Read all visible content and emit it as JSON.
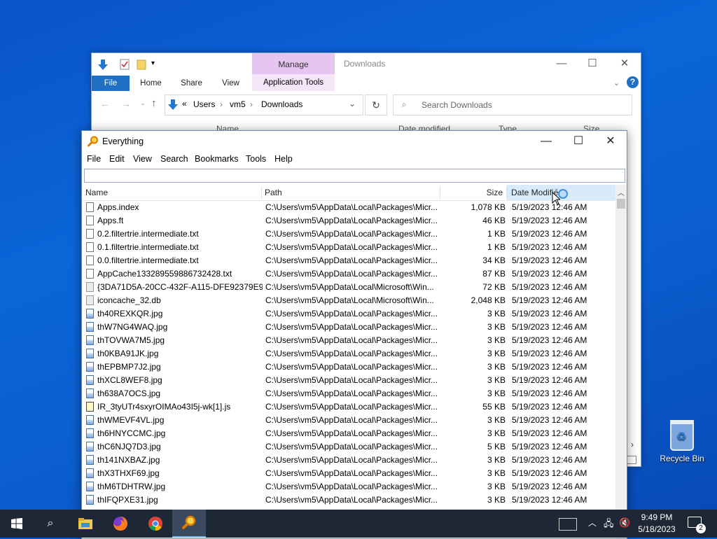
{
  "explorer": {
    "title": "Downloads",
    "manage_label": "Manage",
    "tabs": {
      "file": "File",
      "home": "Home",
      "share": "Share",
      "view": "View",
      "app_tools": "Application Tools"
    },
    "breadcrumb": {
      "sep": "«",
      "items": [
        "Users",
        "vm5",
        "Downloads"
      ]
    },
    "search_placeholder": "Search Downloads",
    "columns": [
      "Name",
      "Date modified",
      "Type",
      "Size"
    ]
  },
  "everything": {
    "title": "Everything",
    "menu": [
      "File",
      "Edit",
      "View",
      "Search",
      "Bookmarks",
      "Tools",
      "Help"
    ],
    "search_value": "",
    "columns": {
      "name": "Name",
      "path": "Path",
      "size": "Size",
      "date": "Date Modified"
    },
    "rows": [
      {
        "name": "Apps.index",
        "path": "C:\\Users\\vm5\\AppData\\Local\\Packages\\Micr...",
        "size": "1,078 KB",
        "date": "5/19/2023 12:46 AM",
        "icon": "file-icon"
      },
      {
        "name": "Apps.ft",
        "path": "C:\\Users\\vm5\\AppData\\Local\\Packages\\Micr...",
        "size": "46 KB",
        "date": "5/19/2023 12:46 AM",
        "icon": "file-icon"
      },
      {
        "name": "0.2.filtertrie.intermediate.txt",
        "path": "C:\\Users\\vm5\\AppData\\Local\\Packages\\Micr...",
        "size": "1 KB",
        "date": "5/19/2023 12:46 AM",
        "icon": "text-file-icon"
      },
      {
        "name": "0.1.filtertrie.intermediate.txt",
        "path": "C:\\Users\\vm5\\AppData\\Local\\Packages\\Micr...",
        "size": "1 KB",
        "date": "5/19/2023 12:46 AM",
        "icon": "text-file-icon"
      },
      {
        "name": "0.0.filtertrie.intermediate.txt",
        "path": "C:\\Users\\vm5\\AppData\\Local\\Packages\\Micr...",
        "size": "34 KB",
        "date": "5/19/2023 12:46 AM",
        "icon": "text-file-icon"
      },
      {
        "name": "AppCache133289559886732428.txt",
        "path": "C:\\Users\\vm5\\AppData\\Local\\Packages\\Micr...",
        "size": "87 KB",
        "date": "5/19/2023 12:46 AM",
        "icon": "text-file-icon"
      },
      {
        "name": "{3DA71D5A-20CC-432F-A115-DFE92379E9...",
        "path": "C:\\Users\\vm5\\AppData\\Local\\Microsoft\\Win...",
        "size": "72 KB",
        "date": "5/19/2023 12:46 AM",
        "icon": "db-file-icon"
      },
      {
        "name": "iconcache_32.db",
        "path": "C:\\Users\\vm5\\AppData\\Local\\Microsoft\\Win...",
        "size": "2,048 KB",
        "date": "5/19/2023 12:46 AM",
        "icon": "db-file-icon"
      },
      {
        "name": "th40REXKQR.jpg",
        "path": "C:\\Users\\vm5\\AppData\\Local\\Packages\\Micr...",
        "size": "3 KB",
        "date": "5/19/2023 12:46 AM",
        "icon": "image-file-icon"
      },
      {
        "name": "thW7NG4WAQ.jpg",
        "path": "C:\\Users\\vm5\\AppData\\Local\\Packages\\Micr...",
        "size": "3 KB",
        "date": "5/19/2023 12:46 AM",
        "icon": "image-file-icon"
      },
      {
        "name": "thTOVWA7M5.jpg",
        "path": "C:\\Users\\vm5\\AppData\\Local\\Packages\\Micr...",
        "size": "3 KB",
        "date": "5/19/2023 12:46 AM",
        "icon": "image-file-icon"
      },
      {
        "name": "th0KBA91JK.jpg",
        "path": "C:\\Users\\vm5\\AppData\\Local\\Packages\\Micr...",
        "size": "3 KB",
        "date": "5/19/2023 12:46 AM",
        "icon": "image-file-icon"
      },
      {
        "name": "thEPBMP7J2.jpg",
        "path": "C:\\Users\\vm5\\AppData\\Local\\Packages\\Micr...",
        "size": "3 KB",
        "date": "5/19/2023 12:46 AM",
        "icon": "image-file-icon"
      },
      {
        "name": "thXCL8WEF8.jpg",
        "path": "C:\\Users\\vm5\\AppData\\Local\\Packages\\Micr...",
        "size": "3 KB",
        "date": "5/19/2023 12:46 AM",
        "icon": "image-file-icon"
      },
      {
        "name": "th638A7OCS.jpg",
        "path": "C:\\Users\\vm5\\AppData\\Local\\Packages\\Micr...",
        "size": "3 KB",
        "date": "5/19/2023 12:46 AM",
        "icon": "image-file-icon"
      },
      {
        "name": "IR_3tyUTr4sxyrOIMAo43I5j-wk[1].js",
        "path": "C:\\Users\\vm5\\AppData\\Local\\Packages\\Micr...",
        "size": "55 KB",
        "date": "5/19/2023 12:46 AM",
        "icon": "script-file-icon"
      },
      {
        "name": "thWMEVF4VL.jpg",
        "path": "C:\\Users\\vm5\\AppData\\Local\\Packages\\Micr...",
        "size": "3 KB",
        "date": "5/19/2023 12:46 AM",
        "icon": "image-file-icon"
      },
      {
        "name": "th6HNYCCMC.jpg",
        "path": "C:\\Users\\vm5\\AppData\\Local\\Packages\\Micr...",
        "size": "3 KB",
        "date": "5/19/2023 12:46 AM",
        "icon": "image-file-icon"
      },
      {
        "name": "thC6NJQ7D3.jpg",
        "path": "C:\\Users\\vm5\\AppData\\Local\\Packages\\Micr...",
        "size": "5 KB",
        "date": "5/19/2023 12:46 AM",
        "icon": "image-file-icon"
      },
      {
        "name": "th141NXBAZ.jpg",
        "path": "C:\\Users\\vm5\\AppData\\Local\\Packages\\Micr...",
        "size": "3 KB",
        "date": "5/19/2023 12:46 AM",
        "icon": "image-file-icon"
      },
      {
        "name": "thX3THXF69.jpg",
        "path": "C:\\Users\\vm5\\AppData\\Local\\Packages\\Micr...",
        "size": "3 KB",
        "date": "5/19/2023 12:46 AM",
        "icon": "image-file-icon"
      },
      {
        "name": "thM6TDHTRW.jpg",
        "path": "C:\\Users\\vm5\\AppData\\Local\\Packages\\Micr...",
        "size": "3 KB",
        "date": "5/19/2023 12:46 AM",
        "icon": "image-file-icon"
      },
      {
        "name": "thIFQPXE31.jpg",
        "path": "C:\\Users\\vm5\\AppData\\Local\\Packages\\Micr...",
        "size": "3 KB",
        "date": "5/19/2023 12:46 AM",
        "icon": "image-file-icon"
      }
    ]
  },
  "desktop": {
    "recycle_bin_label": "Recycle Bin"
  },
  "taskbar": {
    "time": "9:49 PM",
    "date": "5/18/2023",
    "notification_count": "2"
  },
  "colors": {
    "file_tab": "#1f6fc5",
    "manage_tab": "#e6c6f0",
    "sorted_header": "#d9ebf9",
    "taskbar": "#1d2735",
    "desktop": "#0b5fd3"
  }
}
